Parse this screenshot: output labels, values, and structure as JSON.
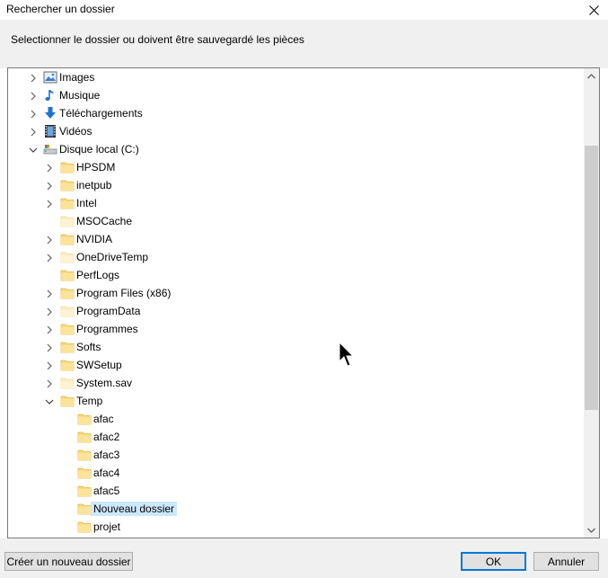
{
  "window": {
    "title": "Rechercher un dossier"
  },
  "instruction": "Selectionner le dossier ou doivent être sauvegardé les pièces",
  "tree": [
    {
      "label": "Images",
      "level": 1,
      "chevron": "right",
      "icon": "images-icon"
    },
    {
      "label": "Musique",
      "level": 1,
      "chevron": "right",
      "icon": "music-icon"
    },
    {
      "label": "Téléchargements",
      "level": 1,
      "chevron": "right",
      "icon": "downloads-icon"
    },
    {
      "label": "Vidéos",
      "level": 1,
      "chevron": "right",
      "icon": "videos-icon"
    },
    {
      "label": "Disque local (C:)",
      "level": 1,
      "chevron": "down",
      "icon": "drive-icon"
    },
    {
      "label": "HPSDM",
      "level": 2,
      "chevron": "right",
      "icon": "folder-icon"
    },
    {
      "label": "inetpub",
      "level": 2,
      "chevron": "right",
      "icon": "folder-icon"
    },
    {
      "label": "Intel",
      "level": 2,
      "chevron": "right",
      "icon": "folder-icon"
    },
    {
      "label": "MSOCache",
      "level": 2,
      "chevron": "none",
      "icon": "folder-faded-icon"
    },
    {
      "label": "NVIDIA",
      "level": 2,
      "chevron": "right",
      "icon": "folder-icon"
    },
    {
      "label": "OneDriveTemp",
      "level": 2,
      "chevron": "right",
      "icon": "folder-faded-icon"
    },
    {
      "label": "PerfLogs",
      "level": 2,
      "chevron": "none",
      "icon": "folder-icon"
    },
    {
      "label": "Program Files (x86)",
      "level": 2,
      "chevron": "right",
      "icon": "folder-icon"
    },
    {
      "label": "ProgramData",
      "level": 2,
      "chevron": "right",
      "icon": "folder-faded-icon"
    },
    {
      "label": "Programmes",
      "level": 2,
      "chevron": "right",
      "icon": "folder-icon"
    },
    {
      "label": "Softs",
      "level": 2,
      "chevron": "right",
      "icon": "folder-icon"
    },
    {
      "label": "SWSetup",
      "level": 2,
      "chevron": "right",
      "icon": "folder-icon"
    },
    {
      "label": "System.sav",
      "level": 2,
      "chevron": "right",
      "icon": "folder-faded-icon"
    },
    {
      "label": "Temp",
      "level": 2,
      "chevron": "down",
      "icon": "folder-icon"
    },
    {
      "label": "afac",
      "level": 3,
      "chevron": "none",
      "icon": "folder-icon"
    },
    {
      "label": "afac2",
      "level": 3,
      "chevron": "none",
      "icon": "folder-icon"
    },
    {
      "label": "afac3",
      "level": 3,
      "chevron": "none",
      "icon": "folder-icon"
    },
    {
      "label": "afac4",
      "level": 3,
      "chevron": "none",
      "icon": "folder-icon"
    },
    {
      "label": "afac5",
      "level": 3,
      "chevron": "none",
      "icon": "folder-icon"
    },
    {
      "label": "Nouveau dossier",
      "level": 3,
      "chevron": "none",
      "icon": "folder-icon",
      "selected": true
    },
    {
      "label": "projet",
      "level": 3,
      "chevron": "none",
      "icon": "folder-icon"
    },
    {
      "label": "",
      "level": 3,
      "chevron": "none",
      "icon": "folder-icon"
    }
  ],
  "buttons": {
    "new_folder": "Créer un nouveau dossier",
    "ok": "OK",
    "cancel": "Annuler"
  },
  "colors": {
    "selection": "#cce8ff",
    "default_button_border": "#0078d7",
    "folder": "#f8d775"
  }
}
